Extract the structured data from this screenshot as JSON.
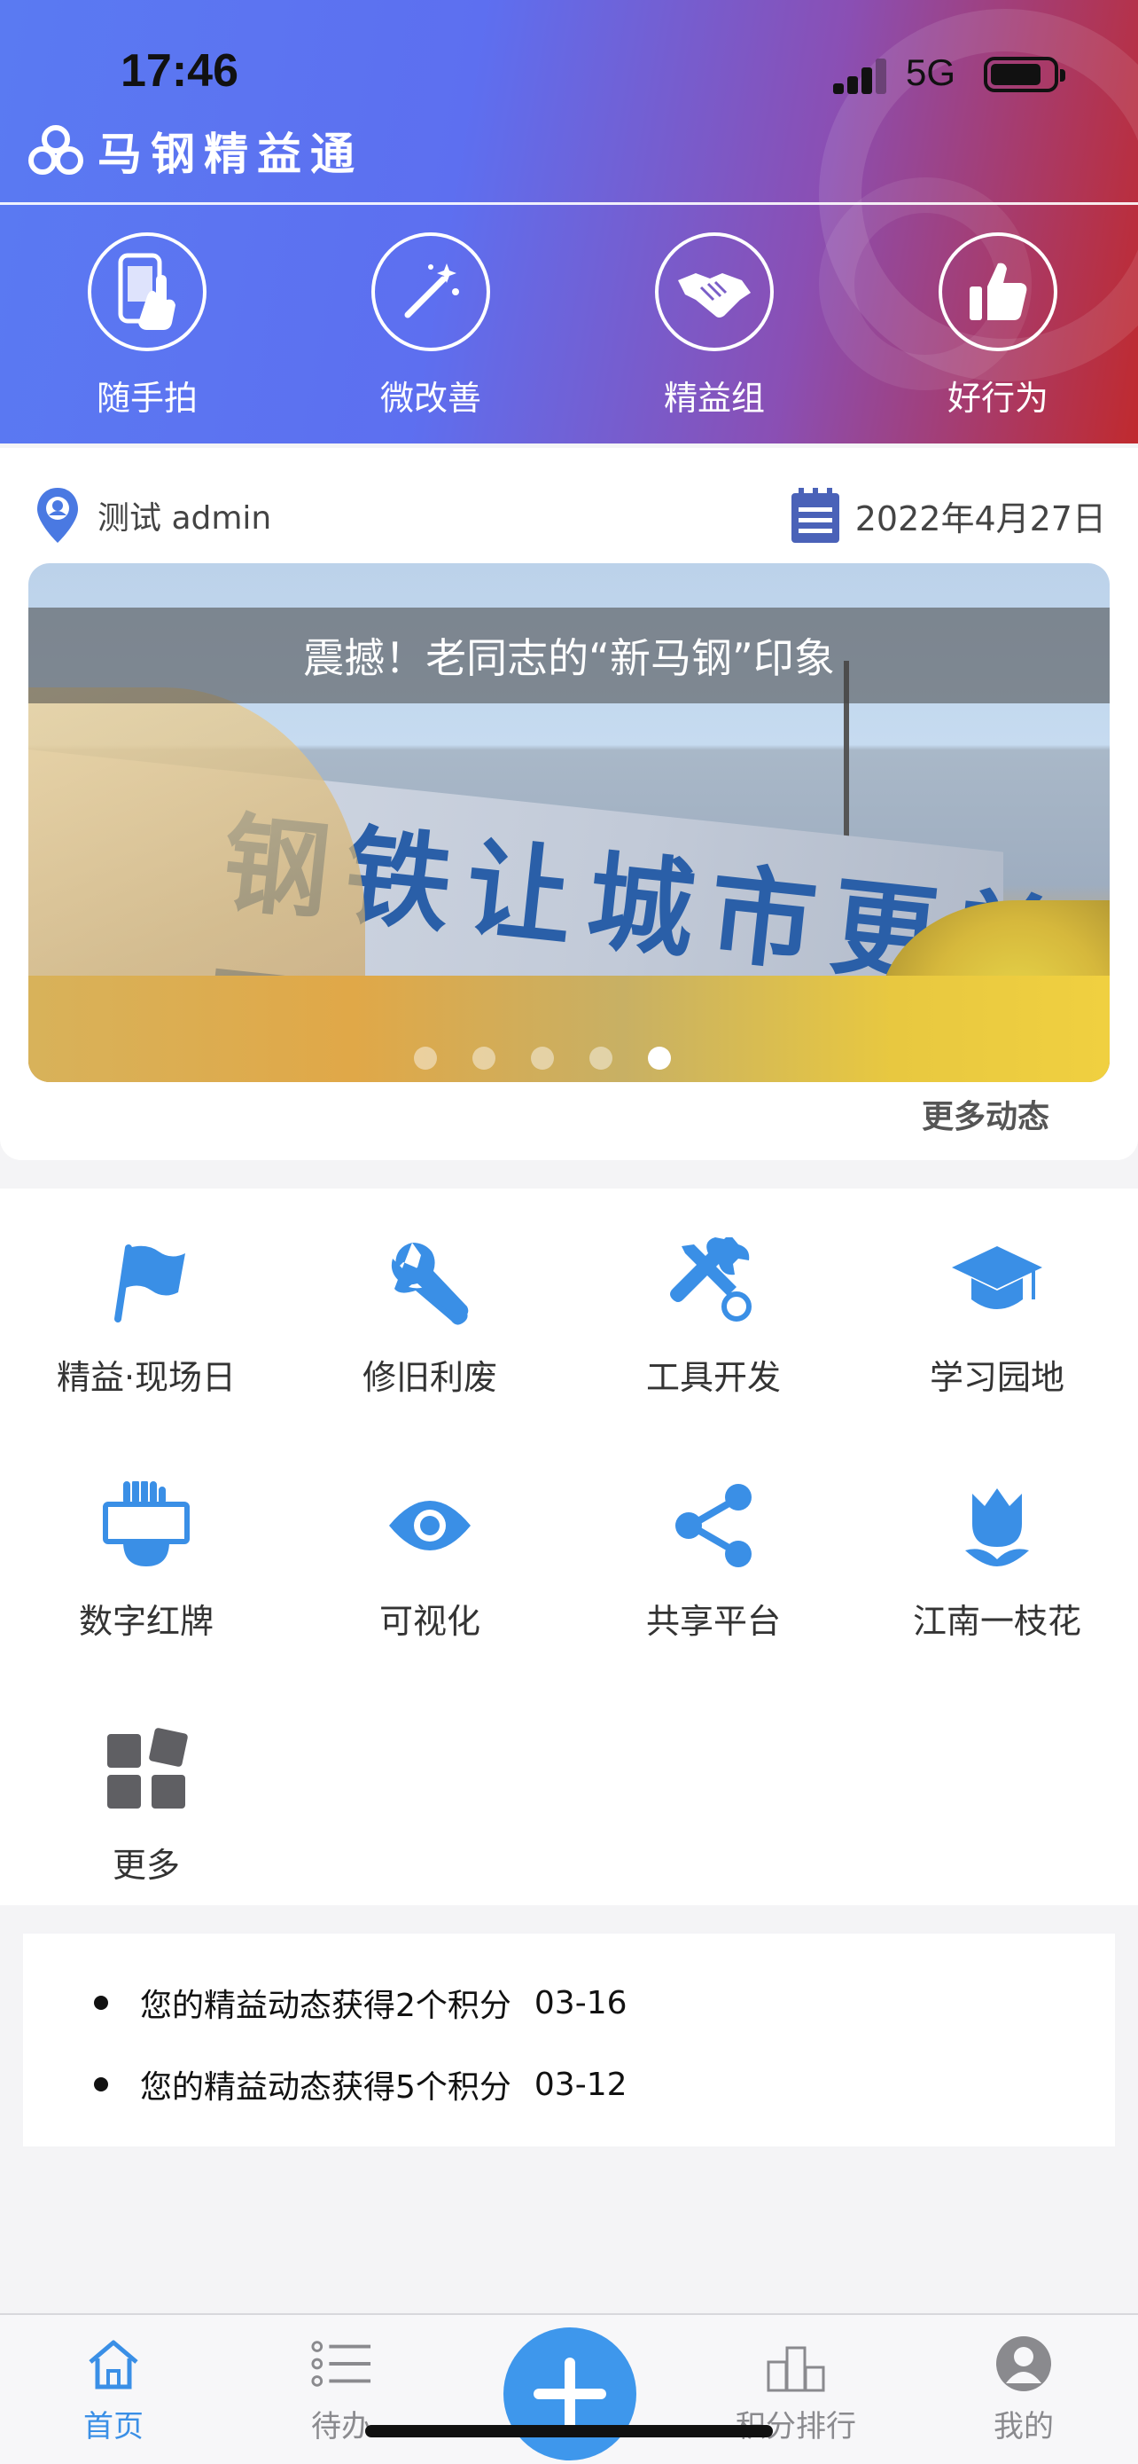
{
  "status_bar": {
    "time": "17:46",
    "network": "5G"
  },
  "header": {
    "app_title": "马钢精益通",
    "quick_actions": [
      {
        "label": "随手拍",
        "icon": "phone-touch-icon"
      },
      {
        "label": "微改善",
        "icon": "magic-wand-icon"
      },
      {
        "label": "精益组",
        "icon": "handshake-icon"
      },
      {
        "label": "好行为",
        "icon": "thumbs-up-icon"
      }
    ]
  },
  "info": {
    "user": "测试 admin",
    "date": "2022年4月27日",
    "banner": {
      "caption": "震撼！老同志的“新马钢”印象",
      "wall_text": "钢铁让城市更美丽",
      "slide_count": 5,
      "active_slide": 5
    },
    "more_news": "更多动态"
  },
  "menu": {
    "items": [
      {
        "label": "精益·现场日",
        "icon": "flag-icon"
      },
      {
        "label": "修旧利废",
        "icon": "wrench-icon"
      },
      {
        "label": "工具开发",
        "icon": "tools-icon"
      },
      {
        "label": "学习园地",
        "icon": "graduation-cap-icon"
      },
      {
        "label": "数字红牌",
        "icon": "hand-sign-icon"
      },
      {
        "label": "可视化",
        "icon": "eye-icon"
      },
      {
        "label": "共享平台",
        "icon": "share-icon"
      },
      {
        "label": "江南一枝花",
        "icon": "tulip-icon"
      },
      {
        "label": "更多",
        "icon": "grid-more-icon"
      }
    ]
  },
  "notices": [
    {
      "text": "您的精益动态获得2个积分",
      "date": "03-16"
    },
    {
      "text": "您的精益动态获得5个积分",
      "date": "03-12"
    }
  ],
  "tab_bar": {
    "tabs": [
      {
        "label": "首页",
        "icon": "home-icon",
        "active": true
      },
      {
        "label": "待办",
        "icon": "list-icon",
        "active": false
      },
      {
        "label": "积分排行",
        "icon": "podium-icon",
        "active": false
      },
      {
        "label": "我的",
        "icon": "user-icon",
        "active": false
      }
    ],
    "accent_color": "#3a8fe6"
  }
}
